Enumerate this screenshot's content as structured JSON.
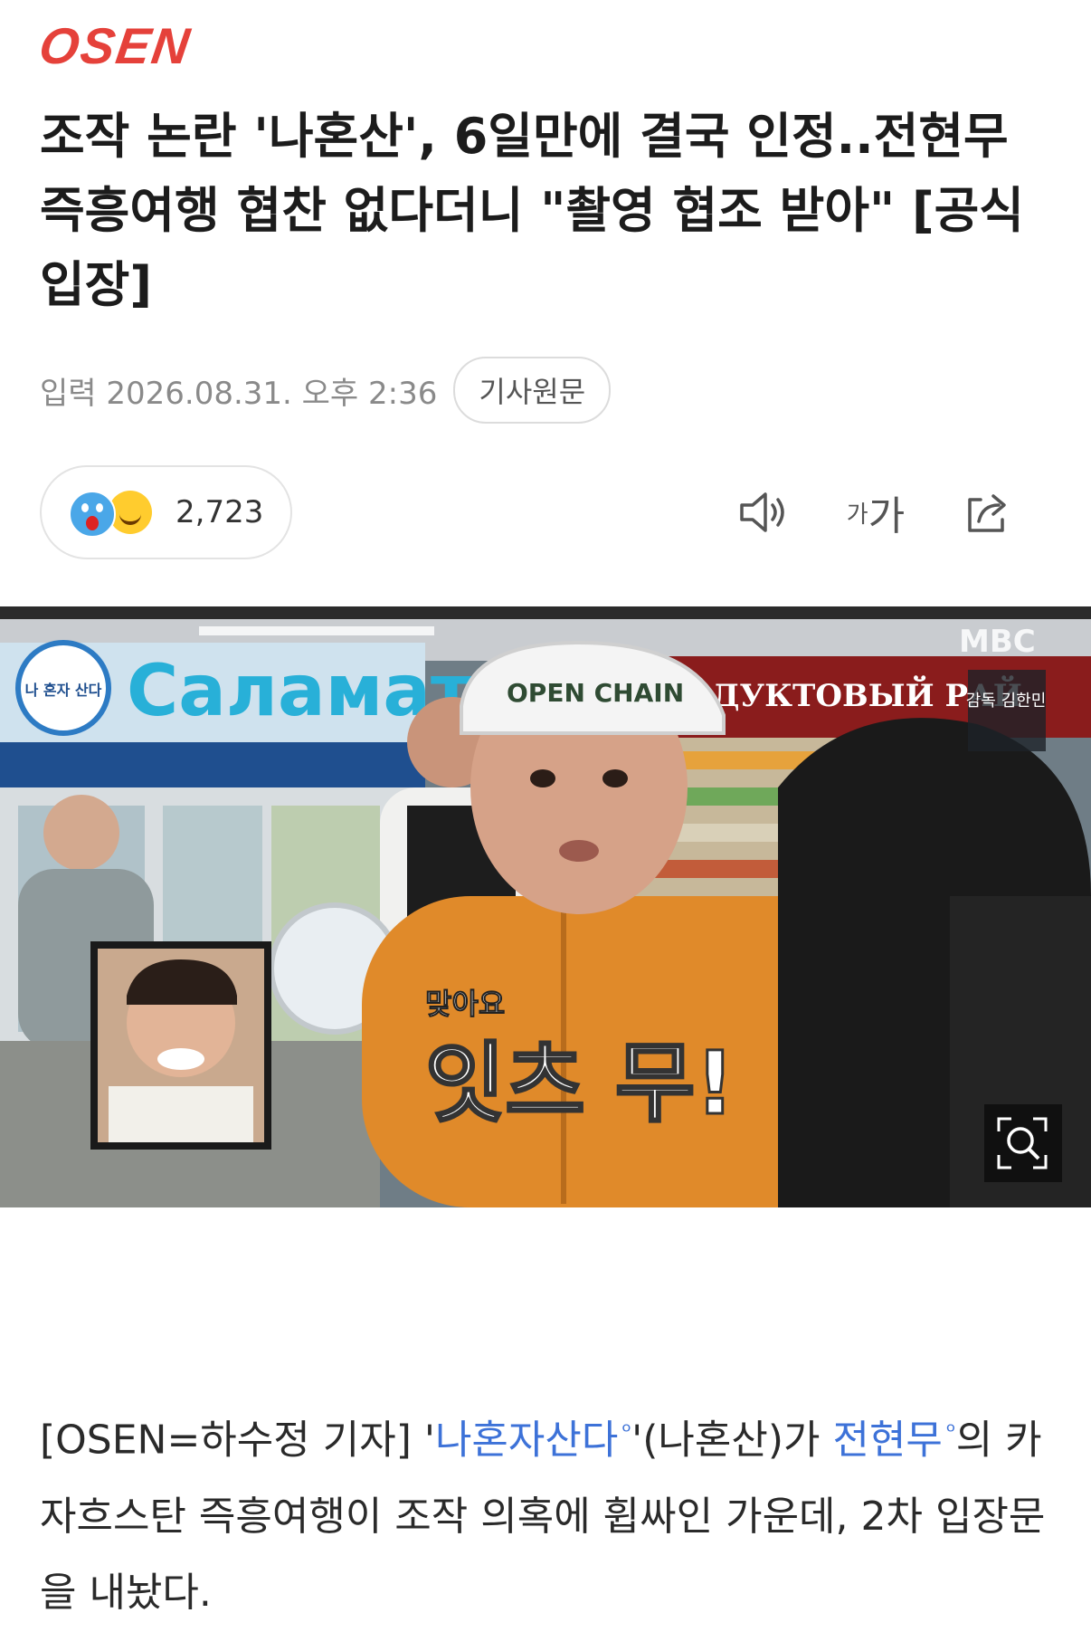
{
  "header": {
    "logo_text": "OSEN"
  },
  "article": {
    "headline": "조작 논란 '나혼산', 6일만에 결국 인정..전현무 즉흥여행 협찬 없다더니 \"촬영 협조 받아\" [공식입장]",
    "date": "입력 2026.08.31. 오후 2:36",
    "source_button": "기사원문",
    "reaction_count": "2,723",
    "font_icon_small": "가",
    "font_icon_large": "가"
  },
  "photo": {
    "store_sign": "Саламат",
    "store_sign2": "ПРОДУКТОВЫЙ РАЙ",
    "cap_text": "OPEN CHAIN",
    "logo_mini": "나 혼자 산다",
    "broadcaster": "MBC",
    "credit": "감독 김한민",
    "subtitle_small": "맞아요",
    "subtitle_big": "잇츠 무!"
  },
  "body": {
    "prefix": "[OSEN=하수정 기자] '",
    "link1": "나혼자산다",
    "mid1": "'(나혼산)가 ",
    "link2": "전현무",
    "rest": "의 카자흐스탄 즉흥여행이 조작 의혹에 휩싸인 가운데, 2차 입장문을 내놨다."
  },
  "colors": {
    "logo": "#e5413a",
    "link": "#3d72d8",
    "muted": "#8a8a8a"
  }
}
